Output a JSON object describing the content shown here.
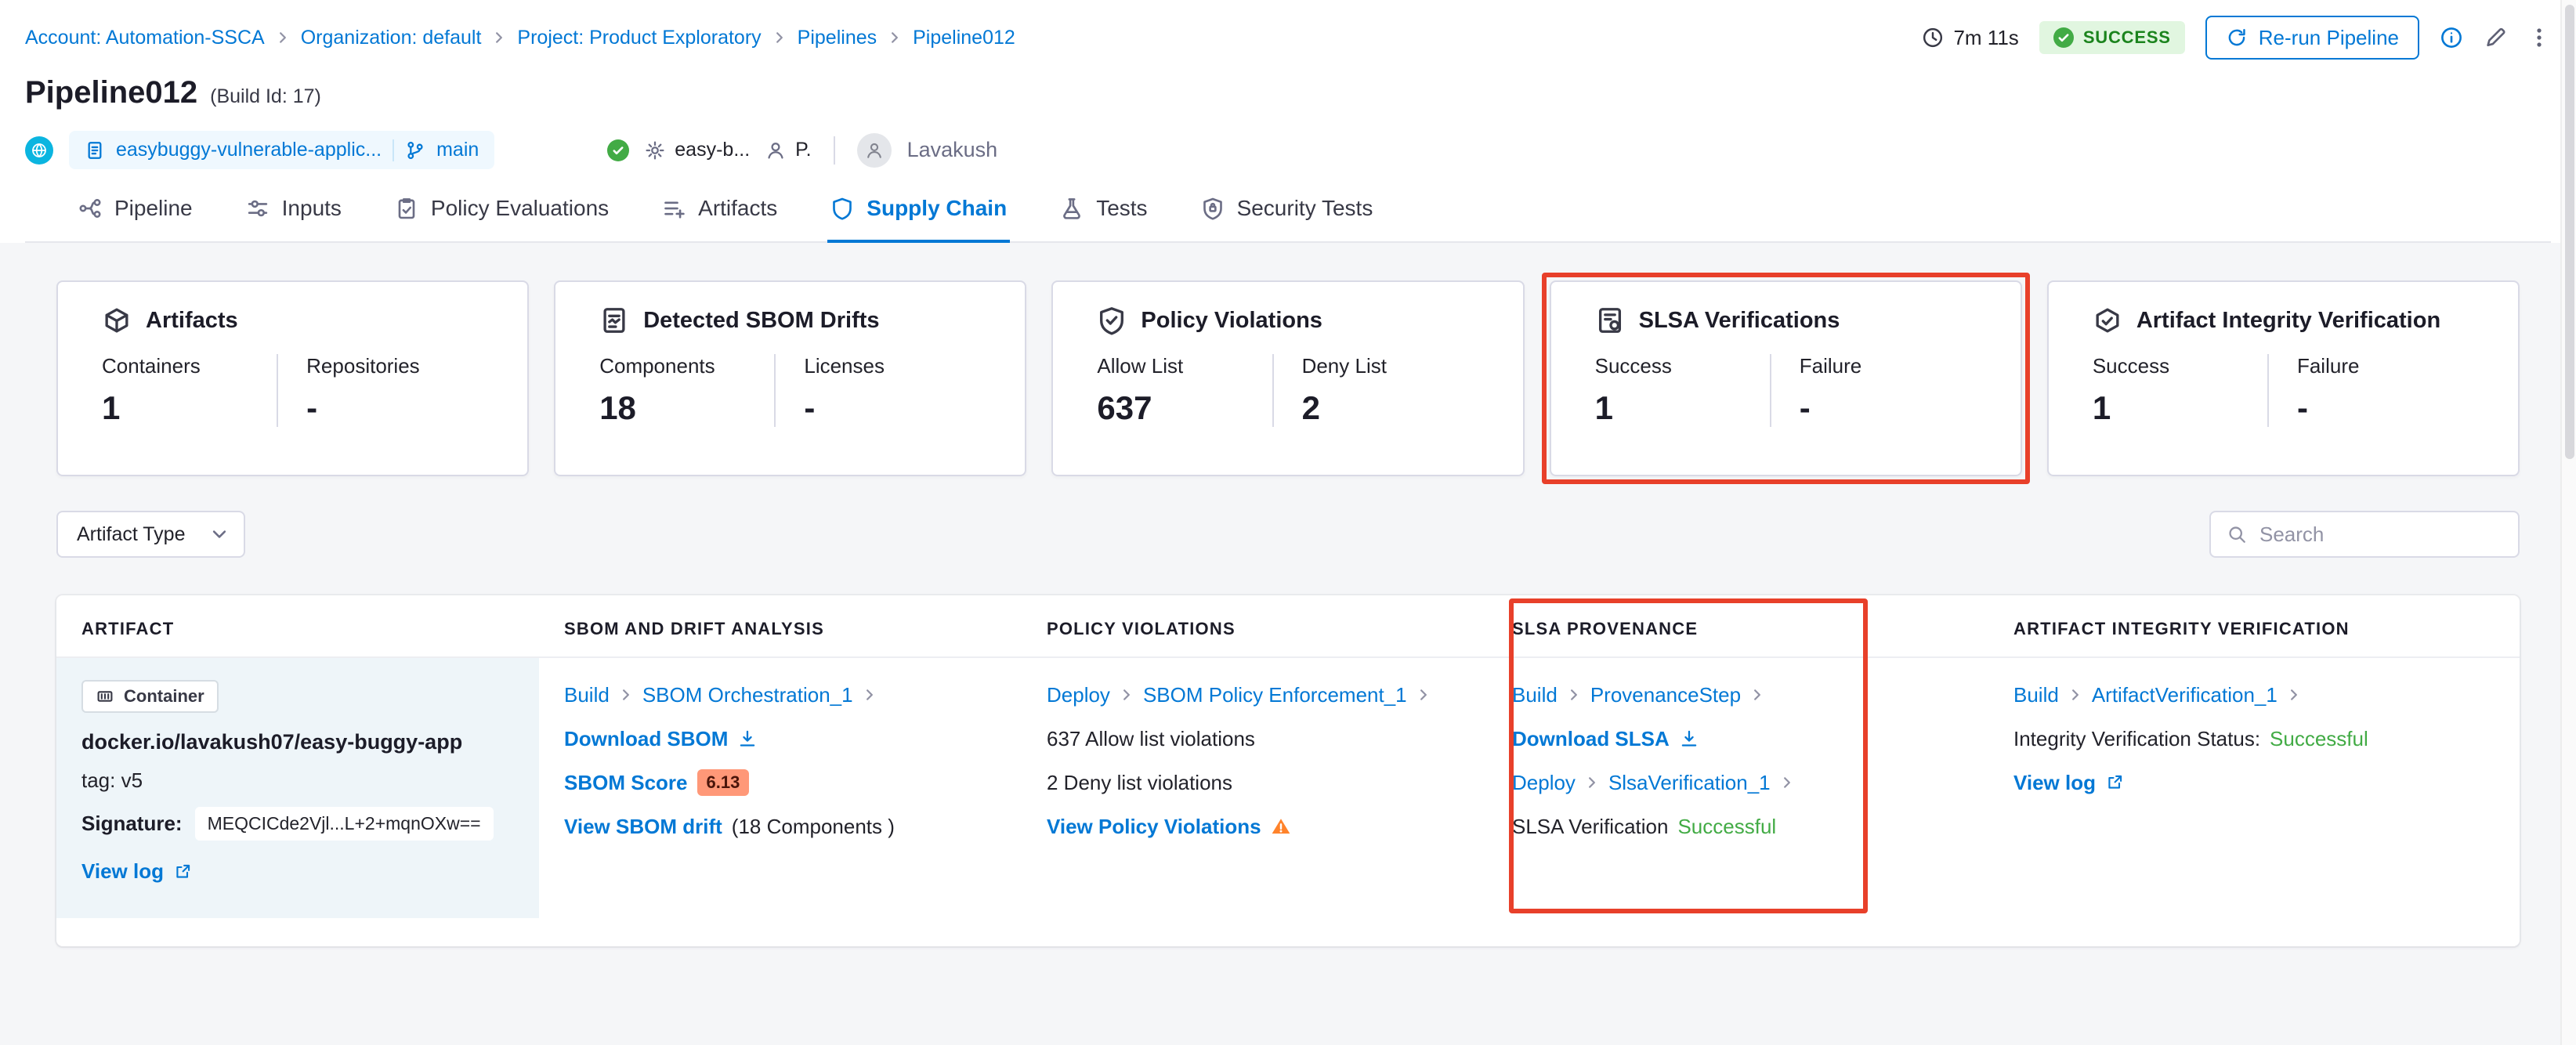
{
  "colors": {
    "accent_blue": "#0278d5",
    "success_green": "#42ab45",
    "badge_green_text": "#1b841d",
    "annotation_red": "#e8402a",
    "score_badge_bg": "#ff9878",
    "warning_orange": "#ff832b"
  },
  "breadcrumb": {
    "items": [
      "Account: Automation-SSCA",
      "Organization: default",
      "Project: Product Exploratory",
      "Pipelines",
      "Pipeline012"
    ]
  },
  "run": {
    "duration": "7m 11s",
    "status": "SUCCESS",
    "rerun_label": "Re-run Pipeline"
  },
  "header": {
    "title": "Pipeline012",
    "build_id": "(Build Id: 17)",
    "repo_name": "easybuggy-vulnerable-applic...",
    "branch": "main",
    "trigger_name": "easy-b...",
    "trigger_short": "P.",
    "user_name": "Lavakush"
  },
  "tabs": [
    {
      "label": "Pipeline"
    },
    {
      "label": "Inputs"
    },
    {
      "label": "Policy Evaluations"
    },
    {
      "label": "Artifacts"
    },
    {
      "label": "Supply Chain"
    },
    {
      "label": "Tests"
    },
    {
      "label": "Security Tests"
    }
  ],
  "summary_cards": [
    {
      "title": "Artifacts",
      "metrics": [
        {
          "label": "Containers",
          "value": "1"
        },
        {
          "label": "Repositories",
          "value": "-"
        }
      ]
    },
    {
      "title": "Detected SBOM Drifts",
      "metrics": [
        {
          "label": "Components",
          "value": "18"
        },
        {
          "label": "Licenses",
          "value": "-"
        }
      ]
    },
    {
      "title": "Policy Violations",
      "metrics": [
        {
          "label": "Allow List",
          "value": "637"
        },
        {
          "label": "Deny List",
          "value": "2"
        }
      ]
    },
    {
      "title": "SLSA Verifications",
      "metrics": [
        {
          "label": "Success",
          "value": "1"
        },
        {
          "label": "Failure",
          "value": "-"
        }
      ]
    },
    {
      "title": "Artifact Integrity Verification",
      "metrics": [
        {
          "label": "Success",
          "value": "1"
        },
        {
          "label": "Failure",
          "value": "-"
        }
      ]
    }
  ],
  "filters": {
    "artifact_type_label": "Artifact Type",
    "search_placeholder": "Search"
  },
  "table": {
    "headers": [
      "ARTIFACT",
      "SBOM AND DRIFT ANALYSIS",
      "POLICY VIOLATIONS",
      "SLSA PROVENANCE",
      "ARTIFACT INTEGRITY VERIFICATION"
    ],
    "row": {
      "artifact": {
        "type": "Container",
        "name": "docker.io/lavakush07/easy-buggy-app",
        "tag": "tag: v5",
        "signature_label": "Signature:",
        "signature_value": "MEQCICde2Vjl...L+2+mqnOXw==",
        "view_log": "View log"
      },
      "sbom": {
        "stage": "Build",
        "step": "SBOM Orchestration_1",
        "download_label": "Download SBOM",
        "score_label": "SBOM Score",
        "score_value": "6.13",
        "drift_label": "View SBOM drift",
        "drift_detail": "(18 Components )"
      },
      "policy": {
        "stage": "Deploy",
        "step": "SBOM Policy Enforcement_1",
        "allow_text": "637 Allow list violations",
        "deny_text": "2 Deny list violations",
        "link_label": "View Policy Violations"
      },
      "slsa": {
        "stage1": "Build",
        "step1": "ProvenanceStep",
        "download_label": "Download SLSA",
        "stage2": "Deploy",
        "step2": "SlsaVerification_1",
        "status_label": "SLSA Verification",
        "status_value": "Successful"
      },
      "integrity": {
        "stage": "Build",
        "step": "ArtifactVerification_1",
        "status_label": "Integrity Verification Status:",
        "status_value": "Successful",
        "view_log": "View log"
      }
    }
  }
}
